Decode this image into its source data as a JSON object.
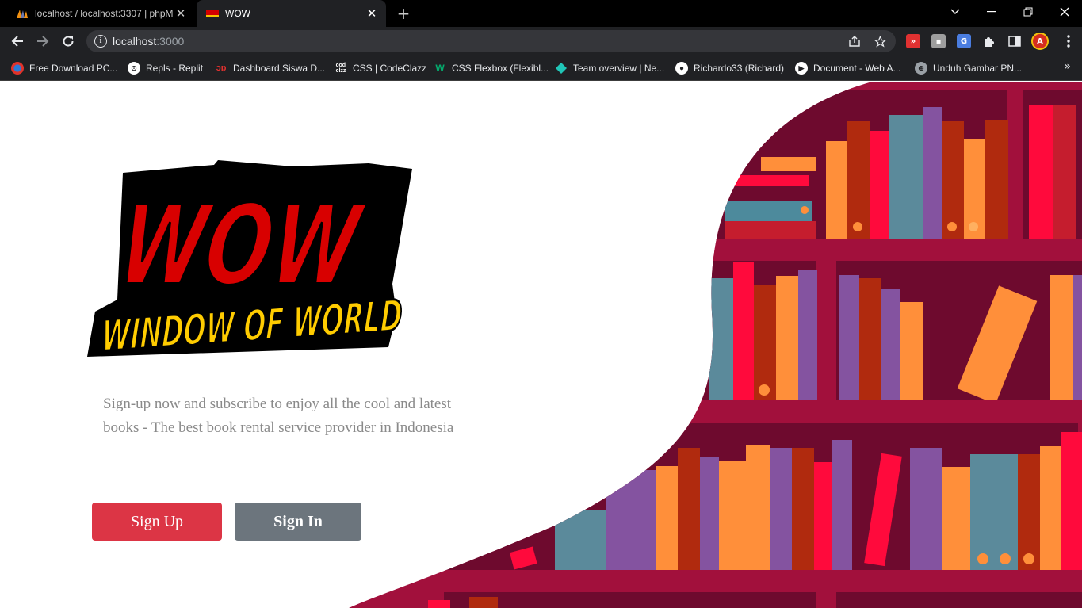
{
  "browser": {
    "tabs": [
      {
        "title": "localhost / localhost:3307 | phpM",
        "active": false,
        "icon": "phpmyadmin-icon"
      },
      {
        "title": "WOW",
        "active": true,
        "icon": "wow-favicon-icon"
      }
    ],
    "new_tab_label": "+",
    "address": {
      "host": "localhost",
      "port": ":3000"
    },
    "bookmarks": [
      {
        "label": "Free Download PC...",
        "icon": "gamecity-icon"
      },
      {
        "label": "Repls - Replit",
        "icon": "replit-icon"
      },
      {
        "label": "Dashboard Siswa D...",
        "icon": "dicoding-icon"
      },
      {
        "label": "CSS | CodeClazz",
        "icon": "codeclazz-icon"
      },
      {
        "label": "CSS Flexbox (Flexibl...",
        "icon": "w3schools-icon"
      },
      {
        "label": "Team overview | Ne...",
        "icon": "netlify-icon"
      },
      {
        "label": "Richardo33 (Richard)",
        "icon": "github-icon"
      },
      {
        "label": "Document - Web A...",
        "icon": "webapp-icon"
      },
      {
        "label": "Unduh Gambar PN...",
        "icon": "globe-icon"
      }
    ]
  },
  "page": {
    "logo": {
      "line1": "WOW",
      "line2": "WINDOW OF WORLD"
    },
    "tagline": "Sign-up now and subscribe to enjoy all the cool and latest books - The best book rental service provider in Indonesia",
    "signup_label": "Sign Up",
    "signin_label": "Sign In"
  },
  "colors": {
    "signup": "#dc3545",
    "signin": "#6c757d",
    "shelf": "#9e0f3a",
    "shelf_back": "#6e0a2e"
  }
}
